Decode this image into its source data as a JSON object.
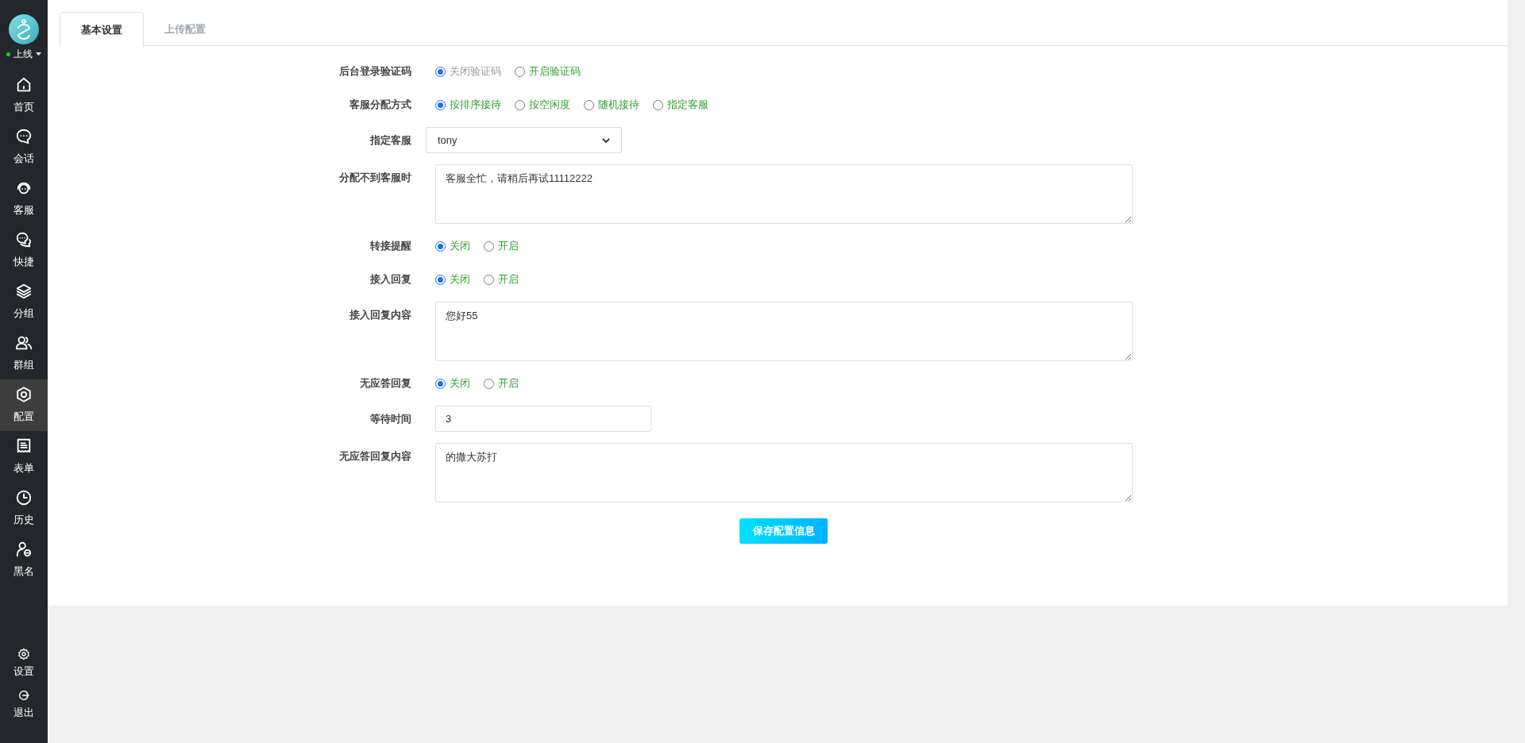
{
  "sidebar": {
    "status": {
      "label": "上线",
      "online": true
    },
    "items": [
      {
        "label": "首页",
        "selected": false
      },
      {
        "label": "会话",
        "selected": false
      },
      {
        "label": "客服",
        "selected": false
      },
      {
        "label": "快捷",
        "selected": false
      },
      {
        "label": "分组",
        "selected": false
      },
      {
        "label": "群组",
        "selected": false
      },
      {
        "label": "配置",
        "selected": true
      },
      {
        "label": "表单",
        "selected": false
      },
      {
        "label": "历史",
        "selected": false
      },
      {
        "label": "黑名",
        "selected": false
      }
    ],
    "bottom_items": [
      {
        "label": "设置"
      },
      {
        "label": "退出"
      }
    ]
  },
  "tabs": [
    {
      "label": "基本设置",
      "selected": true
    },
    {
      "label": "上传配置",
      "selected": false
    }
  ],
  "form": {
    "fields": [
      {
        "kind": "radio",
        "label": "后台登录验证码",
        "options": [
          {
            "label": "关闭验证码",
            "selected": true,
            "color": "#999999"
          },
          {
            "label": "开启验证码",
            "selected": false,
            "color": "#2e9e2e"
          }
        ]
      },
      {
        "kind": "radio",
        "label": "客服分配方式",
        "options": [
          {
            "label": "按排序接待",
            "selected": true,
            "color": "#2e9e2e"
          },
          {
            "label": "按空闲度",
            "selected": false,
            "color": "#2e9e2e"
          },
          {
            "label": "随机接待",
            "selected": false,
            "color": "#2e9e2e"
          },
          {
            "label": "指定客服",
            "selected": false,
            "color": "#2e9e2e"
          }
        ]
      },
      {
        "kind": "select",
        "label": "指定客服",
        "value": "tony"
      },
      {
        "kind": "textarea",
        "label": "分配不到客服时",
        "value": "客服全忙，请稍后再试11112222"
      },
      {
        "kind": "radio",
        "label": "转接提醒",
        "options": [
          {
            "label": "关闭",
            "selected": true,
            "color": "#2e9e2e"
          },
          {
            "label": "开启",
            "selected": false,
            "color": "#2e9e2e"
          }
        ]
      },
      {
        "kind": "radio",
        "label": "接入回复",
        "options": [
          {
            "label": "关闭",
            "selected": true,
            "color": "#2e9e2e"
          },
          {
            "label": "开启",
            "selected": false,
            "color": "#2e9e2e"
          }
        ]
      },
      {
        "kind": "textarea",
        "label": "接入回复内容",
        "value": "您好55"
      },
      {
        "kind": "radio",
        "label": "无应答回复",
        "options": [
          {
            "label": "关闭",
            "selected": true,
            "color": "#2e9e2e"
          },
          {
            "label": "开启",
            "selected": false,
            "color": "#2e9e2e"
          }
        ]
      },
      {
        "kind": "input",
        "label": "等待时间",
        "value": "3"
      },
      {
        "kind": "textarea",
        "label": "无应答回复内容",
        "value": "的撒大苏打"
      }
    ],
    "save_button": "保存配置信息"
  }
}
